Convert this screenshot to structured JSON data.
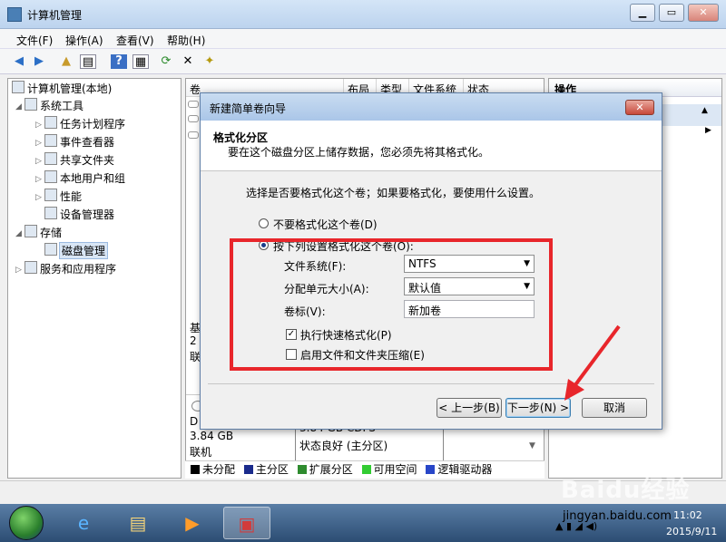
{
  "window": {
    "title": "计算机管理",
    "min_glyph": "▁",
    "max_glyph": "▭",
    "close_glyph": "✕"
  },
  "menu": [
    "文件(F)",
    "操作(A)",
    "查看(V)",
    "帮助(H)"
  ],
  "toolbar_icons": [
    "back-icon",
    "forward-icon",
    "up-folder-icon",
    "show-hide-tree-icon",
    "help-icon",
    "properties-icon",
    "refresh-icon",
    "delete-icon",
    "wizard-icon"
  ],
  "tree": [
    {
      "label": "计算机管理(本地)",
      "icon": "computer-icon",
      "level": 0,
      "arrow": ""
    },
    {
      "label": "系统工具",
      "icon": "tools-icon",
      "level": 1,
      "arrow": "◢"
    },
    {
      "label": "任务计划程序",
      "icon": "clock-icon",
      "level": 2,
      "arrow": "▷"
    },
    {
      "label": "事件查看器",
      "icon": "event-icon",
      "level": 2,
      "arrow": "▷"
    },
    {
      "label": "共享文件夹",
      "icon": "shared-folder-icon",
      "level": 2,
      "arrow": "▷"
    },
    {
      "label": "本地用户和组",
      "icon": "users-icon",
      "level": 2,
      "arrow": "▷"
    },
    {
      "label": "性能",
      "icon": "performance-icon",
      "level": 2,
      "arrow": "▷"
    },
    {
      "label": "设备管理器",
      "icon": "device-icon",
      "level": 2,
      "arrow": ""
    },
    {
      "label": "存储",
      "icon": "storage-icon",
      "level": 1,
      "arrow": "◢"
    },
    {
      "label": "磁盘管理",
      "icon": "disk-icon",
      "level": 2,
      "arrow": "",
      "selected": true
    },
    {
      "label": "服务和应用程序",
      "icon": "services-icon",
      "level": 1,
      "arrow": "▷"
    }
  ],
  "columns": [
    "卷",
    "布局",
    "类型",
    "文件系统",
    "状态"
  ],
  "disk_panel": {
    "left_lines": [
      "基",
      "2",
      "联"
    ],
    "cd_letter": "D",
    "cd_size": "3.84 GB",
    "cd_status": "联机",
    "volume_size": "3.84 GB CDFS",
    "volume_status": "状态良好 (主分区)"
  },
  "actions": {
    "header": "操作"
  },
  "legend": [
    {
      "label": "未分配",
      "color": "#000000"
    },
    {
      "label": "主分区",
      "color": "#1a2b8c"
    },
    {
      "label": "扩展分区",
      "color": "#2e8b2e"
    },
    {
      "label": "可用空间",
      "color": "#33cc33"
    },
    {
      "label": "逻辑驱动器",
      "color": "#2846c8"
    }
  ],
  "dialog": {
    "title": "新建简单卷向导",
    "close_glyph": "✕",
    "header_title": "格式化分区",
    "header_subtitle": "要在这个磁盘分区上储存数据，您必须先将其格式化。",
    "prompt": "选择是否要格式化这个卷；如果要格式化，要使用什么设置。",
    "radio_no_format": "不要格式化这个卷(D)",
    "radio_format": "按下列设置格式化这个卷(O):",
    "fs_label": "文件系统(F):",
    "fs_value": "NTFS",
    "alloc_label": "分配单元大小(A):",
    "alloc_value": "默认值",
    "vol_label_label": "卷标(V):",
    "vol_label_value": "新加卷",
    "quick_format": "执行快速格式化(P)",
    "compression": "启用文件和文件夹压缩(E)",
    "back": "< 上一步(B)",
    "next": "下一步(N) >",
    "cancel": "取消"
  },
  "taskbar": {
    "time": "11:02",
    "date": "2015/9/11",
    "watermark_url": "jingyan.baidu.com",
    "watermark_brand": "Baidu经验"
  }
}
